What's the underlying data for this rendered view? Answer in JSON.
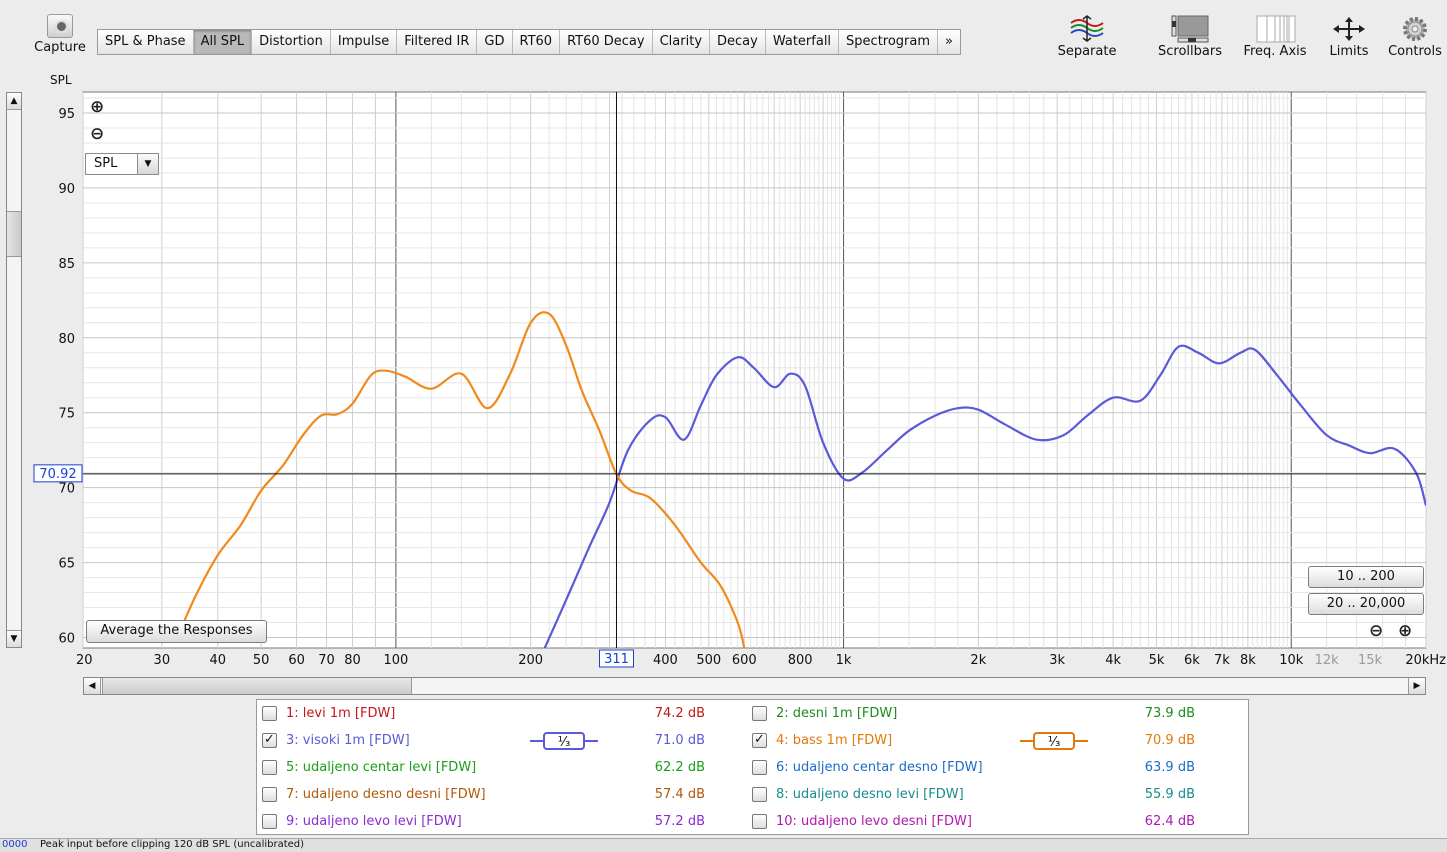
{
  "toolbar": {
    "capture_label": "Capture",
    "tabs": [
      "SPL & Phase",
      "All SPL",
      "Distortion",
      "Impulse",
      "Filtered IR",
      "GD",
      "RT60",
      "RT60 Decay",
      "Clarity",
      "Decay",
      "Waterfall",
      "Spectrogram",
      "»"
    ],
    "active_tab": "All SPL",
    "separate_label": "Separate",
    "scrollbars_label": "Scrollbars",
    "freq_axis_label": "Freq. Axis",
    "limits_label": "Limits",
    "controls_label": "Controls"
  },
  "plot": {
    "y_axis_title": "SPL",
    "spl_select_value": "SPL",
    "average_button_label": "Average the Responses",
    "range_btn_1": "10 .. 200",
    "range_btn_2": "20 .. 20,000",
    "cursor_y_label": "70.92",
    "cursor_x_label": "311"
  },
  "chart_data": {
    "type": "line",
    "xscale": "log",
    "xlim": [
      20,
      20000
    ],
    "ylim": [
      59.3,
      96.4
    ],
    "y_ticks": [
      60,
      65,
      70,
      75,
      80,
      85,
      90,
      95
    ],
    "x_tick_labels": [
      {
        "v": 20,
        "t": "20"
      },
      {
        "v": 30,
        "t": "30"
      },
      {
        "v": 40,
        "t": "40"
      },
      {
        "v": 50,
        "t": "50"
      },
      {
        "v": 60,
        "t": "60"
      },
      {
        "v": 70,
        "t": "70"
      },
      {
        "v": 80,
        "t": "80"
      },
      {
        "v": 100,
        "t": "100"
      },
      {
        "v": 200,
        "t": "200"
      },
      {
        "v": 400,
        "t": "400"
      },
      {
        "v": 500,
        "t": "500"
      },
      {
        "v": 600,
        "t": "600"
      },
      {
        "v": 800,
        "t": "800"
      },
      {
        "v": 1000,
        "t": "1k"
      },
      {
        "v": 2000,
        "t": "2k"
      },
      {
        "v": 3000,
        "t": "3k"
      },
      {
        "v": 4000,
        "t": "4k"
      },
      {
        "v": 5000,
        "t": "5k"
      },
      {
        "v": 6000,
        "t": "6k"
      },
      {
        "v": 7000,
        "t": "7k"
      },
      {
        "v": 8000,
        "t": "8k"
      },
      {
        "v": 10000,
        "t": "10k"
      },
      {
        "v": 12000,
        "t": "12k",
        "dim": true
      },
      {
        "v": 15000,
        "t": "15k",
        "dim": true
      },
      {
        "v": 20000,
        "t": "20kHz"
      }
    ],
    "cursor": {
      "x": 311,
      "y": 70.92
    },
    "series": [
      {
        "name": "3: visoki 1m [FDW]",
        "color": "#5a5ad8",
        "x": [
          215,
          240,
          270,
          300,
          330,
          370,
          400,
          440,
          480,
          520,
          580,
          630,
          700,
          760,
          820,
          900,
          1000,
          1100,
          1250,
          1400,
          1600,
          1800,
          2000,
          2300,
          2700,
          3100,
          3500,
          4000,
          4600,
          5100,
          5600,
          6200,
          6900,
          7700,
          8300,
          9300,
          10500,
          12000,
          13500,
          15000,
          17000,
          19000,
          20000
        ],
        "y": [
          59.3,
          62.5,
          66,
          69,
          72.5,
          74.5,
          74.7,
          73.2,
          75.5,
          77.5,
          78.7,
          78,
          76.7,
          77.6,
          76.8,
          73,
          70.6,
          71,
          72.5,
          73.8,
          74.8,
          75.3,
          75.2,
          74.2,
          73.2,
          73.5,
          74.8,
          76,
          75.8,
          77.5,
          79.4,
          79,
          78.3,
          79,
          79.2,
          77.5,
          75.5,
          73.5,
          72.8,
          72.3,
          72.6,
          71,
          68.8
        ]
      },
      {
        "name": "4: bass 1m [FDW]",
        "color": "#f08a1c",
        "x": [
          33,
          36,
          40,
          45,
          50,
          56,
          62,
          68,
          74,
          80,
          88,
          95,
          105,
          120,
          140,
          160,
          180,
          200,
          220,
          240,
          260,
          285,
          311,
          335,
          370,
          420,
          480,
          530,
          580,
          600
        ],
        "y": [
          60.5,
          63,
          65.5,
          67.5,
          69.8,
          71.5,
          73.5,
          74.8,
          74.9,
          75.6,
          77.5,
          77.8,
          77.4,
          76.6,
          77.6,
          75.3,
          77.6,
          81,
          81.6,
          79.5,
          76.5,
          73.8,
          70.9,
          69.8,
          69.3,
          67.5,
          65,
          63.5,
          61,
          59.3
        ]
      }
    ]
  },
  "legend": [
    {
      "name": "1: levi 1m [FDW]",
      "value": "74.2 dB",
      "color": "#c41818",
      "checked": false
    },
    {
      "name": "2: desni 1m [FDW]",
      "value": "73.9 dB",
      "color": "#1c8c1c",
      "checked": false
    },
    {
      "name": "3: visoki 1m [FDW]",
      "value": "71.0 dB",
      "color": "#5a5ad8",
      "checked": true,
      "smoothing": "1/3"
    },
    {
      "name": "4: bass 1m [FDW]",
      "value": "70.9 dB",
      "color": "#e07a0c",
      "checked": true,
      "smoothing": "1/3"
    },
    {
      "name": "5: udaljeno centar levi [FDW]",
      "value": "62.2 dB",
      "color": "#18a018",
      "checked": false
    },
    {
      "name": "6: udaljeno centar desno [FDW]",
      "value": "63.9 dB",
      "color": "#1c6cc8",
      "checked": false
    },
    {
      "name": "7: udaljeno desno desni [FDW]",
      "value": "57.4 dB",
      "color": "#b05a0c",
      "checked": false
    },
    {
      "name": "8: udaljeno desno levi [FDW]",
      "value": "55.9 dB",
      "color": "#188c8c",
      "checked": false
    },
    {
      "name": "9: udaljeno levo levi [FDW]",
      "value": "57.2 dB",
      "color": "#8a2cd0",
      "checked": false
    },
    {
      "name": "10: udaljeno levo desni [FDW]",
      "value": "62.4 dB",
      "color": "#b018b0",
      "checked": false
    }
  ],
  "status": {
    "number": "0000",
    "text": "Peak input before clipping 120 dB SPL (uncalibrated)"
  }
}
